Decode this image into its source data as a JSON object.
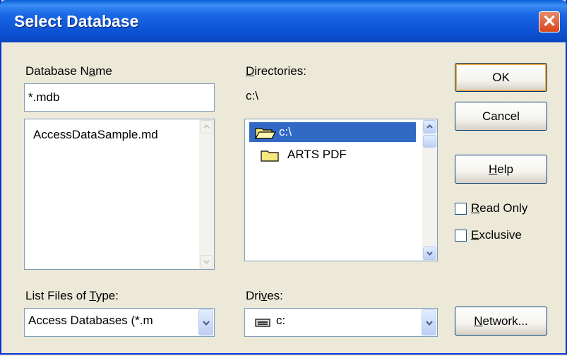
{
  "window": {
    "title": "Select Database",
    "close_icon": "close-icon"
  },
  "database_name": {
    "label": {
      "before": "Database N",
      "underline": "a",
      "after": "me"
    },
    "value": "*.mdb",
    "files": [
      "AccessDataSample.md"
    ]
  },
  "directories": {
    "label": {
      "before": "",
      "underline": "D",
      "after": "irectories:"
    },
    "current_path": "c:\\",
    "items": [
      {
        "name": "c:\\",
        "icon": "open-folder-icon",
        "selected": true
      },
      {
        "name": "ARTS PDF",
        "icon": "folder-icon",
        "selected": false
      }
    ]
  },
  "buttons": {
    "ok": "OK",
    "cancel": "Cancel",
    "help": {
      "before": "",
      "underline": "H",
      "after": "elp"
    },
    "network": {
      "before": "",
      "underline": "N",
      "after": "etwork..."
    }
  },
  "options": {
    "read_only": {
      "before": "",
      "underline": "R",
      "after": "ead Only",
      "checked": false
    },
    "exclusive": {
      "before": "",
      "underline": "E",
      "after": "xclusive",
      "checked": false
    }
  },
  "file_type": {
    "label": {
      "before": "List Files of ",
      "underline": "T",
      "after": "ype:"
    },
    "value": "Access Databases (*.m"
  },
  "drives": {
    "label": {
      "before": "Dri",
      "underline": "v",
      "after": "es:"
    },
    "value": "c:",
    "icon": "drive-icon"
  },
  "colors": {
    "titlebar": "#0B50D0",
    "selection": "#316AC5",
    "face": "#ECE9D8",
    "default_border": "#E8A84A"
  }
}
